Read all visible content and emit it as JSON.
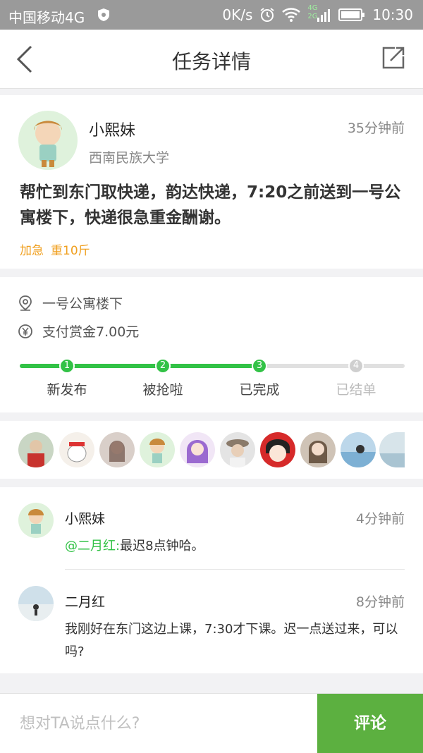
{
  "status_bar": {
    "carrier": "中国移动4G",
    "speed": "0K/s",
    "time": "10:30",
    "network_badge_top": "4G",
    "network_badge_bottom": "2G"
  },
  "nav": {
    "title": "任务详情"
  },
  "task": {
    "user_name": "小熙妹",
    "time_ago": "35分钟前",
    "school": "西南民族大学",
    "content": "帮忙到东门取快递，韵达快递，7:20之前送到一号公寓楼下，快递很急重金酬谢。",
    "tags": [
      "加急",
      "重10斤"
    ]
  },
  "info": {
    "location": "一号公寓楼下",
    "reward": "支付赏金7.00元"
  },
  "progress": {
    "completed_steps": 3,
    "steps": [
      {
        "num": "1",
        "label": "新发布"
      },
      {
        "num": "2",
        "label": "被抢啦"
      },
      {
        "num": "3",
        "label": "已完成"
      },
      {
        "num": "4",
        "label": "已结单"
      }
    ]
  },
  "colors": {
    "accent_green": "#32c246",
    "button_green": "#5cb040",
    "tag_orange": "#f0a020"
  },
  "comments": [
    {
      "name": "小熙妹",
      "time_ago": "4分钟前",
      "mention": "@二月红:",
      "text": "最迟8点钟哈。"
    },
    {
      "name": "二月红",
      "time_ago": "8分钟前",
      "text": "我刚好在东门这边上课，7:30才下课。迟一点送过来，可以吗?"
    }
  ],
  "bottom_bar": {
    "placeholder": "想对TA说点什么?",
    "submit_label": "评论"
  }
}
